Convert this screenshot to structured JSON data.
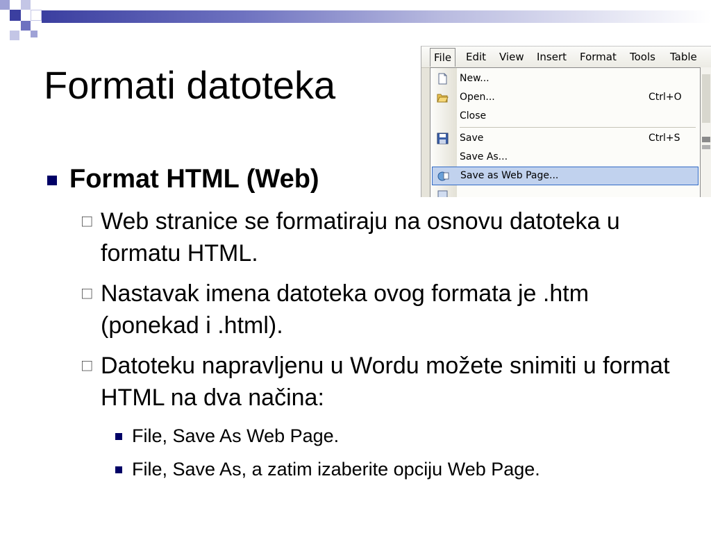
{
  "slide": {
    "title": "Formati datoteka",
    "colors": {
      "bullet": "#000066",
      "accent_bar": "#3b3fa0"
    }
  },
  "menu_screenshot": {
    "menubar": [
      "File",
      "Edit",
      "View",
      "Insert",
      "Format",
      "Tools",
      "Table"
    ],
    "items": [
      {
        "label": "New...",
        "shortcut": "",
        "icon": "new-document-icon"
      },
      {
        "label": "Open...",
        "shortcut": "Ctrl+O",
        "icon": "open-folder-icon"
      },
      {
        "label": "Close",
        "shortcut": "",
        "icon": ""
      },
      {
        "label": "Save",
        "shortcut": "Ctrl+S",
        "icon": "floppy-disk-icon"
      },
      {
        "label": "Save As...",
        "shortcut": "",
        "icon": ""
      },
      {
        "label": "Save as Web Page...",
        "shortcut": "",
        "icon": "web-page-icon"
      }
    ]
  },
  "content": {
    "heading": "Format HTML (Web)",
    "points": [
      "Web stranice se formatiraju na osnovu datoteka u formatu HTML.",
      "Nastavak imena datoteka ovog formata je .htm (ponekad i .html).",
      "Datoteku napravljenu u Wordu možete snimiti u format HTML na dva načina:"
    ],
    "subpoints": [
      "File, Save As Web Page.",
      "File, Save As, a zatim izaberite opciju Web Page."
    ]
  }
}
